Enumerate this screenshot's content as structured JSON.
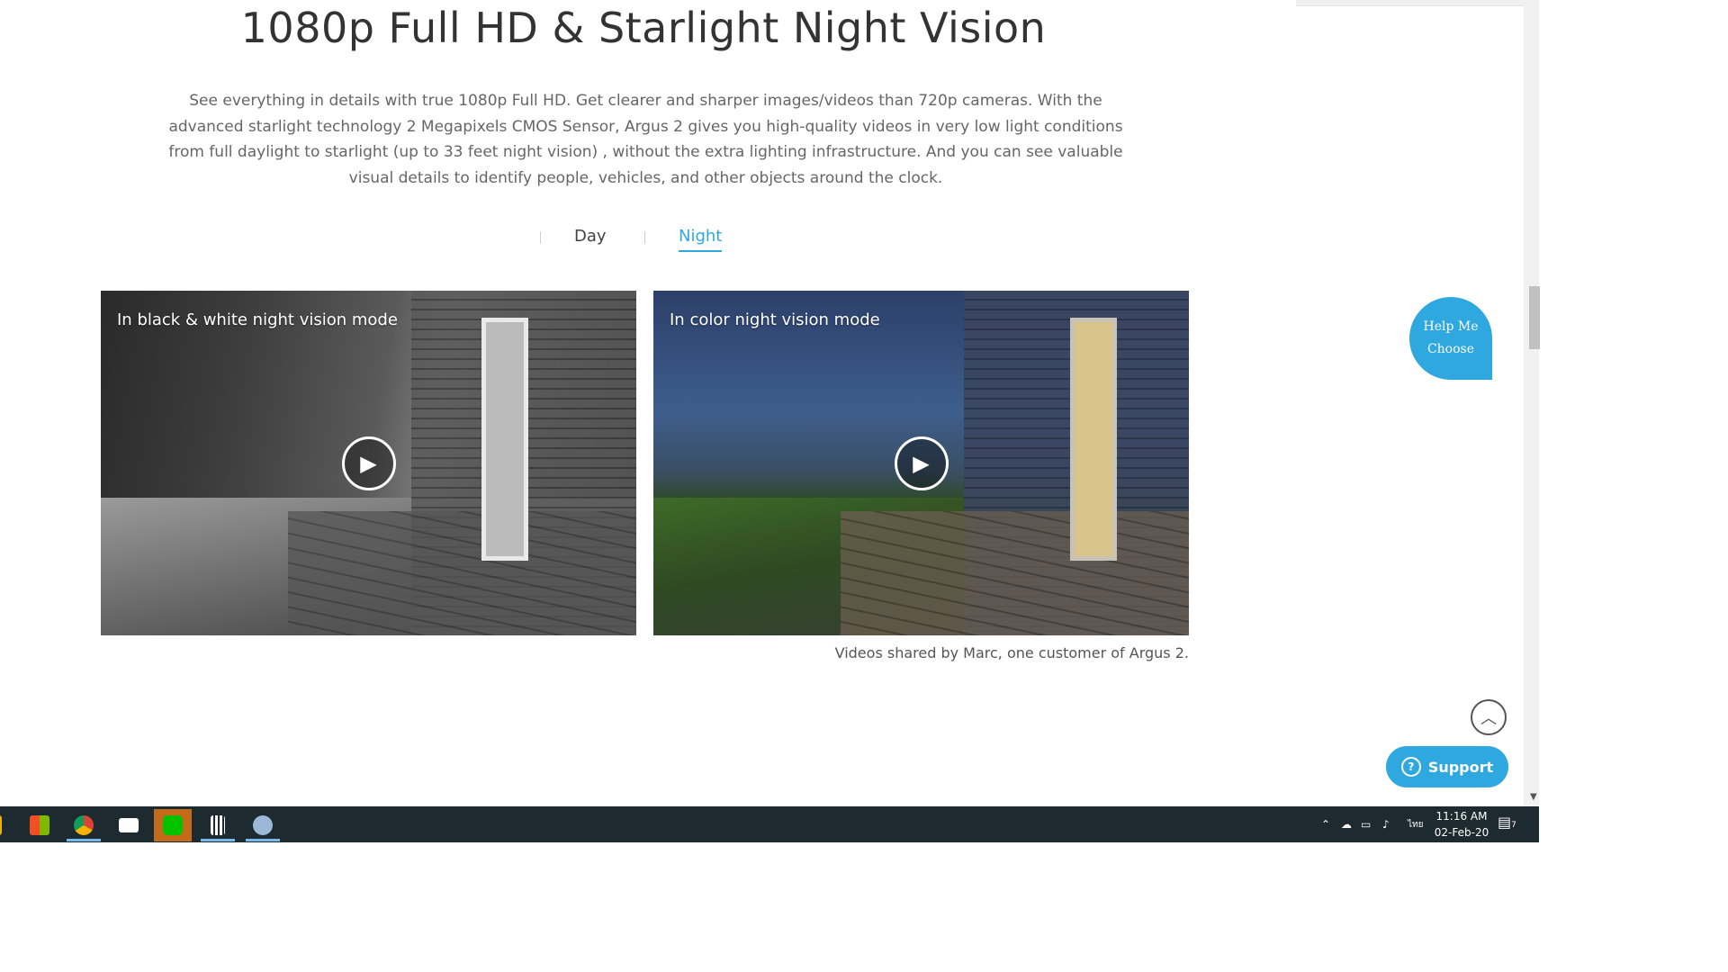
{
  "section": {
    "title": "1080p Full HD & Starlight Night Vision",
    "description": "See everything in details with true 1080p Full HD. Get clearer and sharper images/videos than 720p cameras. With the advanced starlight technology 2 Megapixels CMOS Sensor, Argus 2 gives you high-quality videos in very low light conditions from full daylight to starlight (up to 33 feet night vision) , without the extra lighting infrastructure. And you can see valuable visual details to identify people, vehicles, and other objects around the clock."
  },
  "tabs": [
    {
      "label": "Day",
      "active": false
    },
    {
      "label": "Night",
      "active": true
    }
  ],
  "videos": [
    {
      "caption": "In black & white night vision mode",
      "play_icon": "play-icon"
    },
    {
      "caption": "In color night vision mode",
      "play_icon": "play-icon"
    }
  ],
  "credit": "Videos shared by Marc, one customer of Argus 2.",
  "help": {
    "line1": "Help Me",
    "line2": "Choose"
  },
  "support": {
    "label": "Support"
  },
  "taskbar": {
    "time": "11:16 AM",
    "date": "02-Feb-20",
    "lang": "ไทย",
    "notifications": "7"
  },
  "colors": {
    "accent": "#2fa8e0",
    "taskbar": "#1d2b30"
  }
}
